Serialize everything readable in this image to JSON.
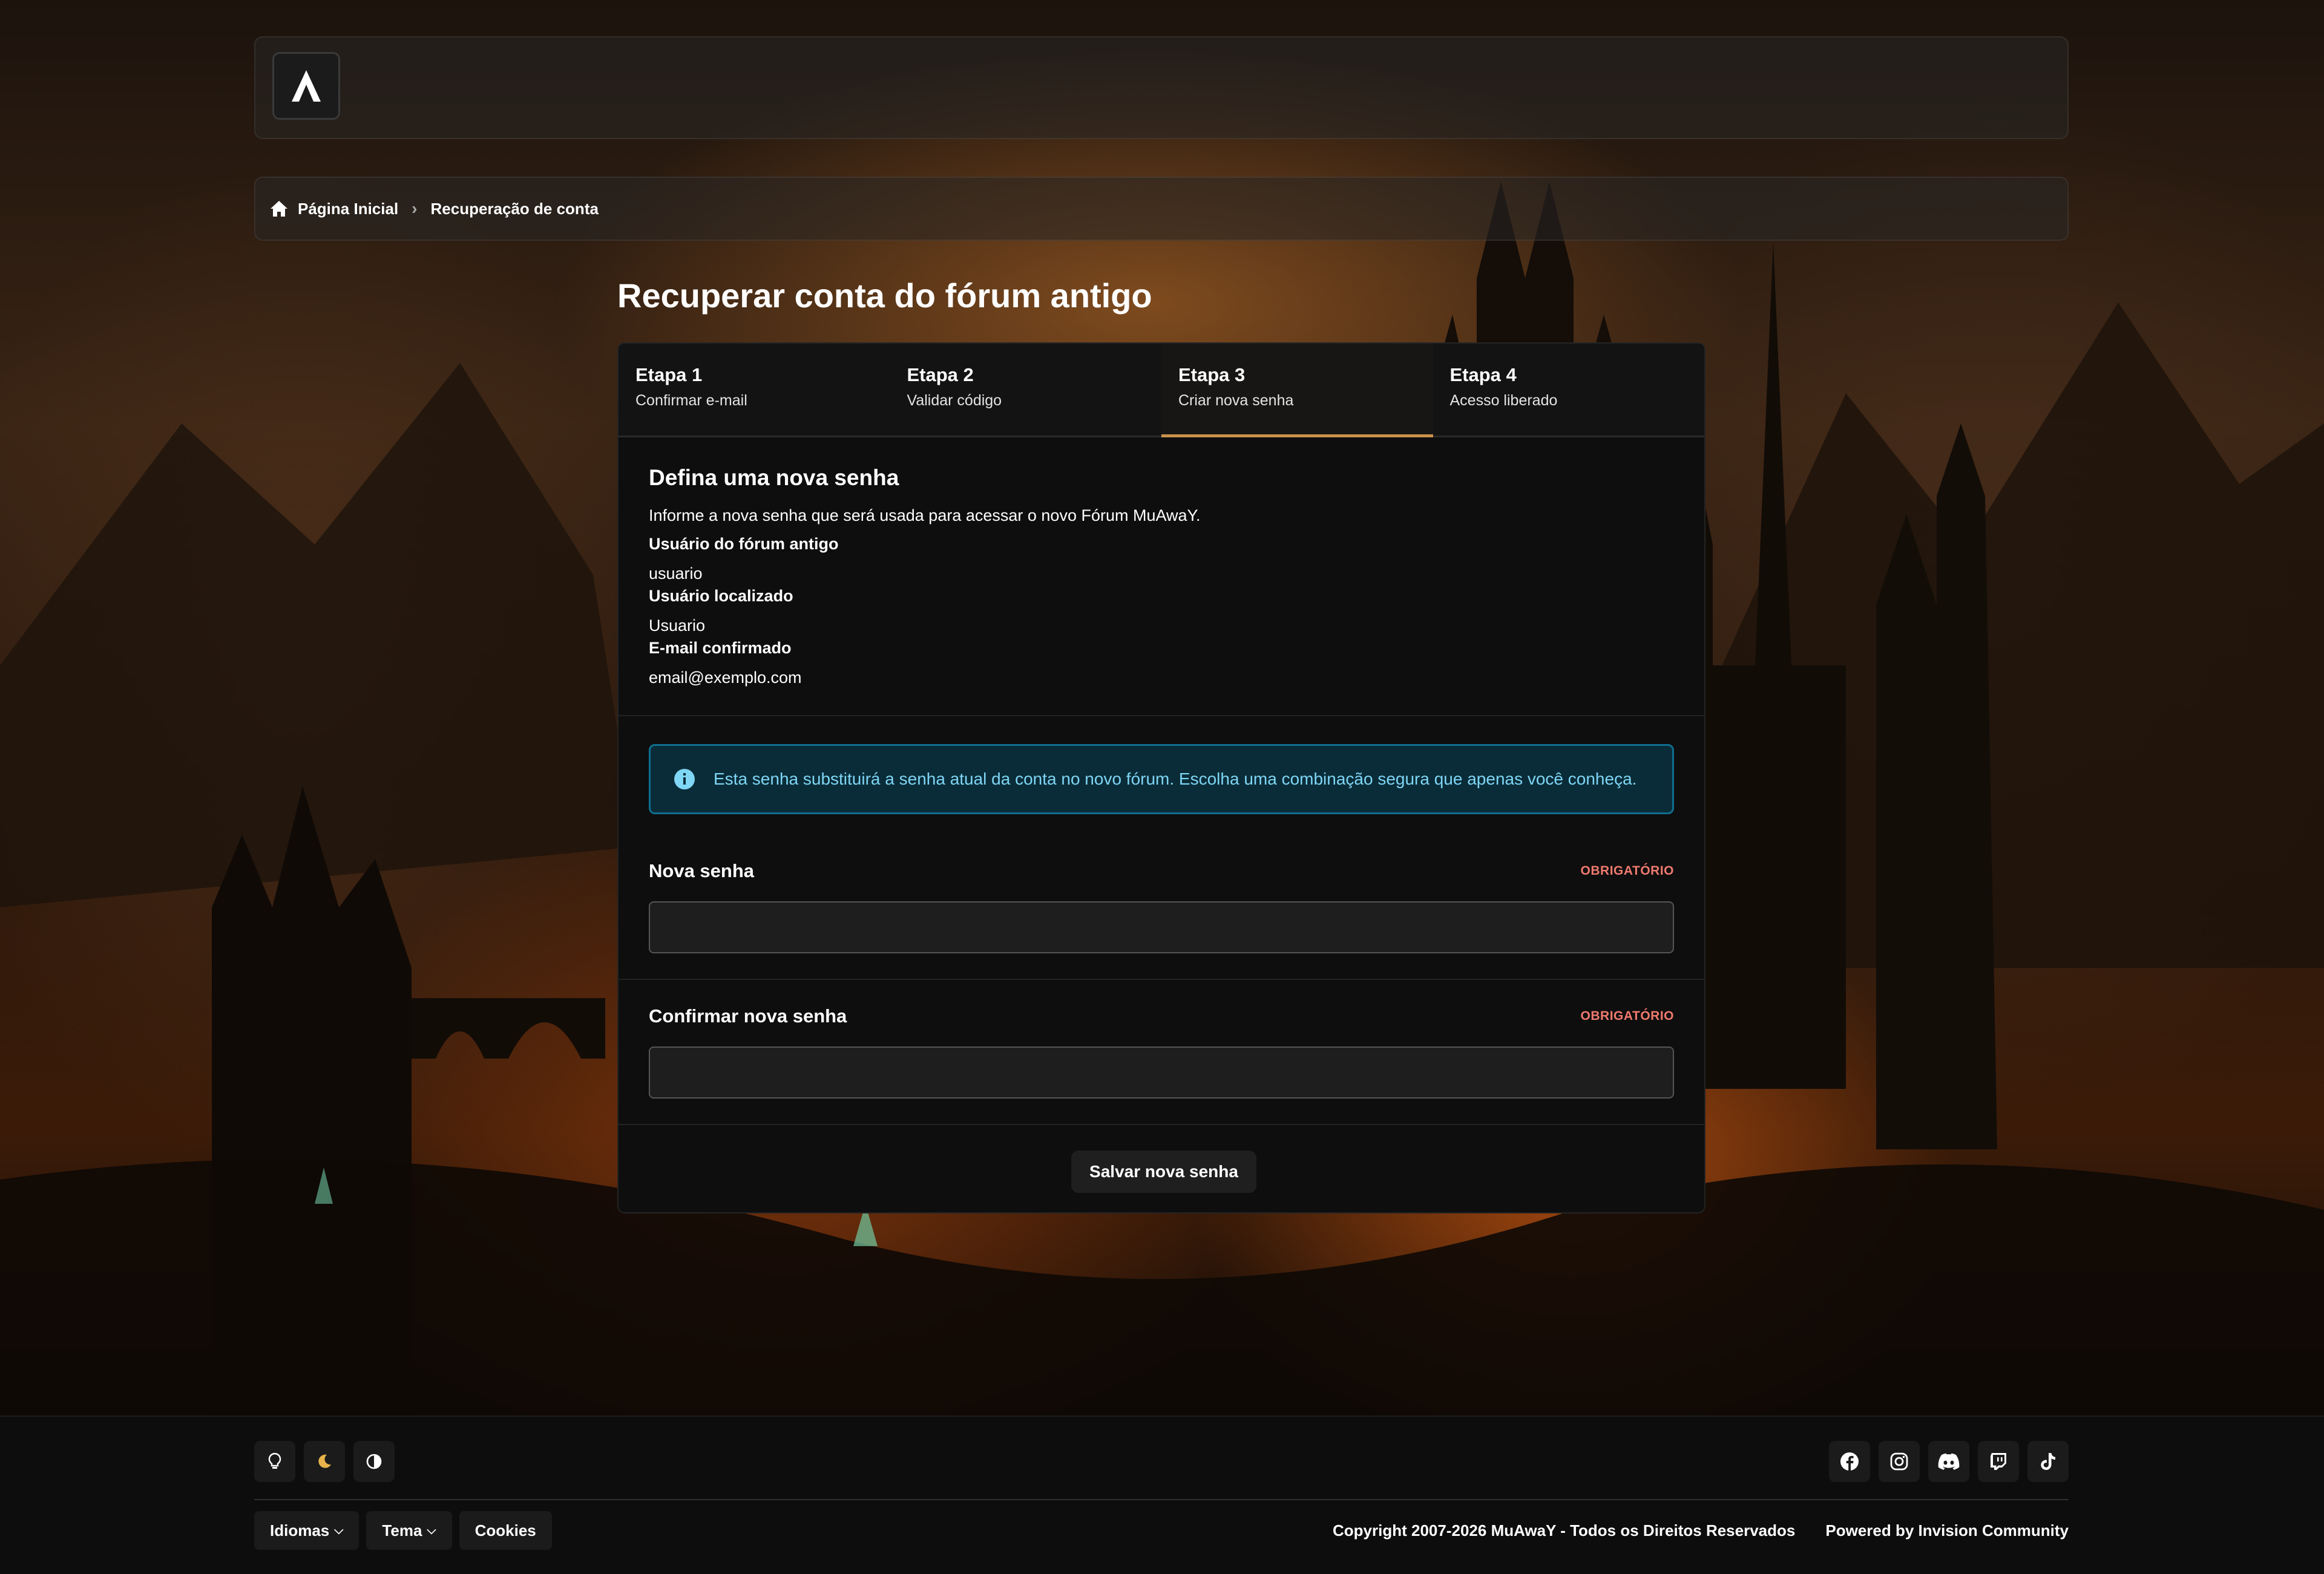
{
  "header": {
    "logo_icon": "muaway-logo-icon"
  },
  "breadcrumb": {
    "home_label": "Página Inicial",
    "current_label": "Recuperação de conta"
  },
  "page": {
    "title": "Recuperar conta do fórum antigo"
  },
  "steps": [
    {
      "num": "Etapa 1",
      "label": "Confirmar e-mail"
    },
    {
      "num": "Etapa 2",
      "label": "Validar código"
    },
    {
      "num": "Etapa 3",
      "label": "Criar nova senha"
    },
    {
      "num": "Etapa 4",
      "label": "Acesso liberado"
    }
  ],
  "active_step": 3,
  "details": {
    "heading": "Defina uma nova senha",
    "intro": "Informe a nova senha que será usada para acessar o novo Fórum MuAwaY.",
    "old_user_label": "Usuário do fórum antigo",
    "old_user_value": "usuario",
    "found_user_label": "Usuário localizado",
    "found_user_value": "Usuario",
    "email_label": "E-mail confirmado",
    "email_value": "email@exemplo.com"
  },
  "info": {
    "text": "Esta senha substituirá a senha atual da conta no novo fórum. Escolha uma combinação segura que apenas você conheça.",
    "color": "#7fd6f5"
  },
  "form": {
    "new_password_label": "Nova senha",
    "confirm_password_label": "Confirmar nova senha",
    "required_label": "OBRIGATÓRIO",
    "submit_label": "Salvar nova senha"
  },
  "footer": {
    "theme_buttons": [
      "lightbulb-icon",
      "moon-icon",
      "contrast-icon"
    ],
    "social": [
      "facebook-icon",
      "instagram-icon",
      "discord-icon",
      "twitch-icon",
      "tiktok-icon"
    ],
    "menu": {
      "languages": "Idiomas",
      "theme": "Tema",
      "cookies": "Cookies"
    },
    "copyright": "Copyright 2007-2026 MuAwaY - Todos os Direitos Reservados",
    "powered": "Powered by Invision Community"
  },
  "colors": {
    "accent": "#c8924a",
    "required": "#ef7a6e",
    "info_border": "#0e6f8e"
  }
}
